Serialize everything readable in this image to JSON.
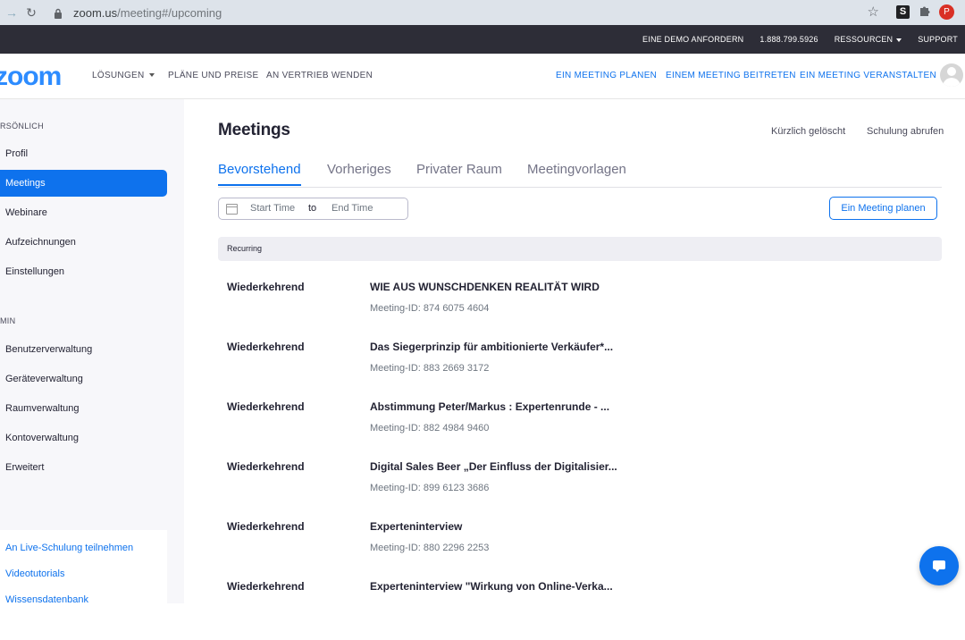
{
  "browser": {
    "url_host": "zoom.us",
    "url_path": "/meeting#/upcoming",
    "profile_initial": "P",
    "extension_label": "S"
  },
  "topbar": {
    "links": [
      "EINE DEMO ANFORDERN",
      "1.888.799.5926",
      "RESSOURCEN",
      "SUPPORT"
    ]
  },
  "nav": {
    "logo": "zoom",
    "left_links": [
      "LÖSUNGEN",
      "PLÄNE UND PREISE",
      "AN VERTRIEB WENDEN"
    ],
    "right_links": [
      "EIN MEETING PLANEN",
      "EINEM MEETING BEITRETEN",
      "EIN MEETING VERANSTALTEN"
    ]
  },
  "sidebar": {
    "section_personal": "RSÖNLICH",
    "personal_items": [
      "Profil",
      "Meetings",
      "Webinare",
      "Aufzeichnungen",
      "Einstellungen"
    ],
    "active_item": "Meetings",
    "section_admin": "MIN",
    "admin_items": [
      "Benutzerverwaltung",
      "Geräteverwaltung",
      "Raumverwaltung",
      "Kontoverwaltung",
      "Erweitert"
    ],
    "help_links": [
      "An Live-Schulung teilnehmen",
      "Videotutorials",
      "Wissensdatenbank"
    ]
  },
  "page": {
    "title": "Meetings",
    "recently_deleted": "Kürzlich gelöscht",
    "training": "Schulung abrufen",
    "tabs": [
      "Bevorstehend",
      "Vorheriges",
      "Privater Raum",
      "Meetingvorlagen"
    ],
    "active_tab": "Bevorstehend",
    "start_placeholder": "Start Time",
    "to_label": "to",
    "end_placeholder": "End Time",
    "schedule_button": "Ein Meeting planen",
    "group_label": "Recurring"
  },
  "meetings": [
    {
      "type": "Wiederkehrend",
      "topic": "WIE AUS WUNSCHDENKEN REALITÄT WIRD",
      "id": "Meeting-ID: 874 6075 4604"
    },
    {
      "type": "Wiederkehrend",
      "topic": "Das Siegerprinzip für ambitionierte Verkäufer*...",
      "id": "Meeting-ID: 883 2669 3172"
    },
    {
      "type": "Wiederkehrend",
      "topic": "Abstimmung Peter/Markus : Expertenrunde - ...",
      "id": "Meeting-ID: 882 4984 9460"
    },
    {
      "type": "Wiederkehrend",
      "topic": "Digital Sales Beer „Der Einfluss der Digitalisier...",
      "id": "Meeting-ID: 899 6123 3686"
    },
    {
      "type": "Wiederkehrend",
      "topic": "Experteninterview",
      "id": "Meeting-ID: 880 2296 2253"
    },
    {
      "type": "Wiederkehrend",
      "topic": "Experteninterview \"Wirkung von Online-Verka...",
      "id": ""
    }
  ]
}
